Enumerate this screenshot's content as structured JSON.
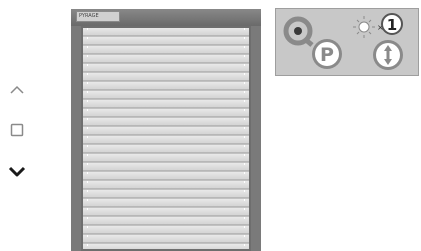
{
  "controls": {
    "up": {
      "icon": "chevron-up-icon"
    },
    "stop": {
      "icon": "square-stop-icon"
    },
    "down": {
      "icon": "chevron-down-icon"
    }
  },
  "shutter": {
    "brand_label": "PYRAGE"
  },
  "status": {
    "parking_badge": "P",
    "sun_multiplier_prefix": "×",
    "sun_multiplier_value": "1",
    "icons": [
      "parking-position-icon",
      "sun-sensor-icon",
      "up-down-icon"
    ]
  },
  "colors": {
    "panel": "#c8c8c8",
    "shutter_frame": "#6e6e6e",
    "slat": "#e8e8e8",
    "icon_gray": "#8a8a8a"
  }
}
